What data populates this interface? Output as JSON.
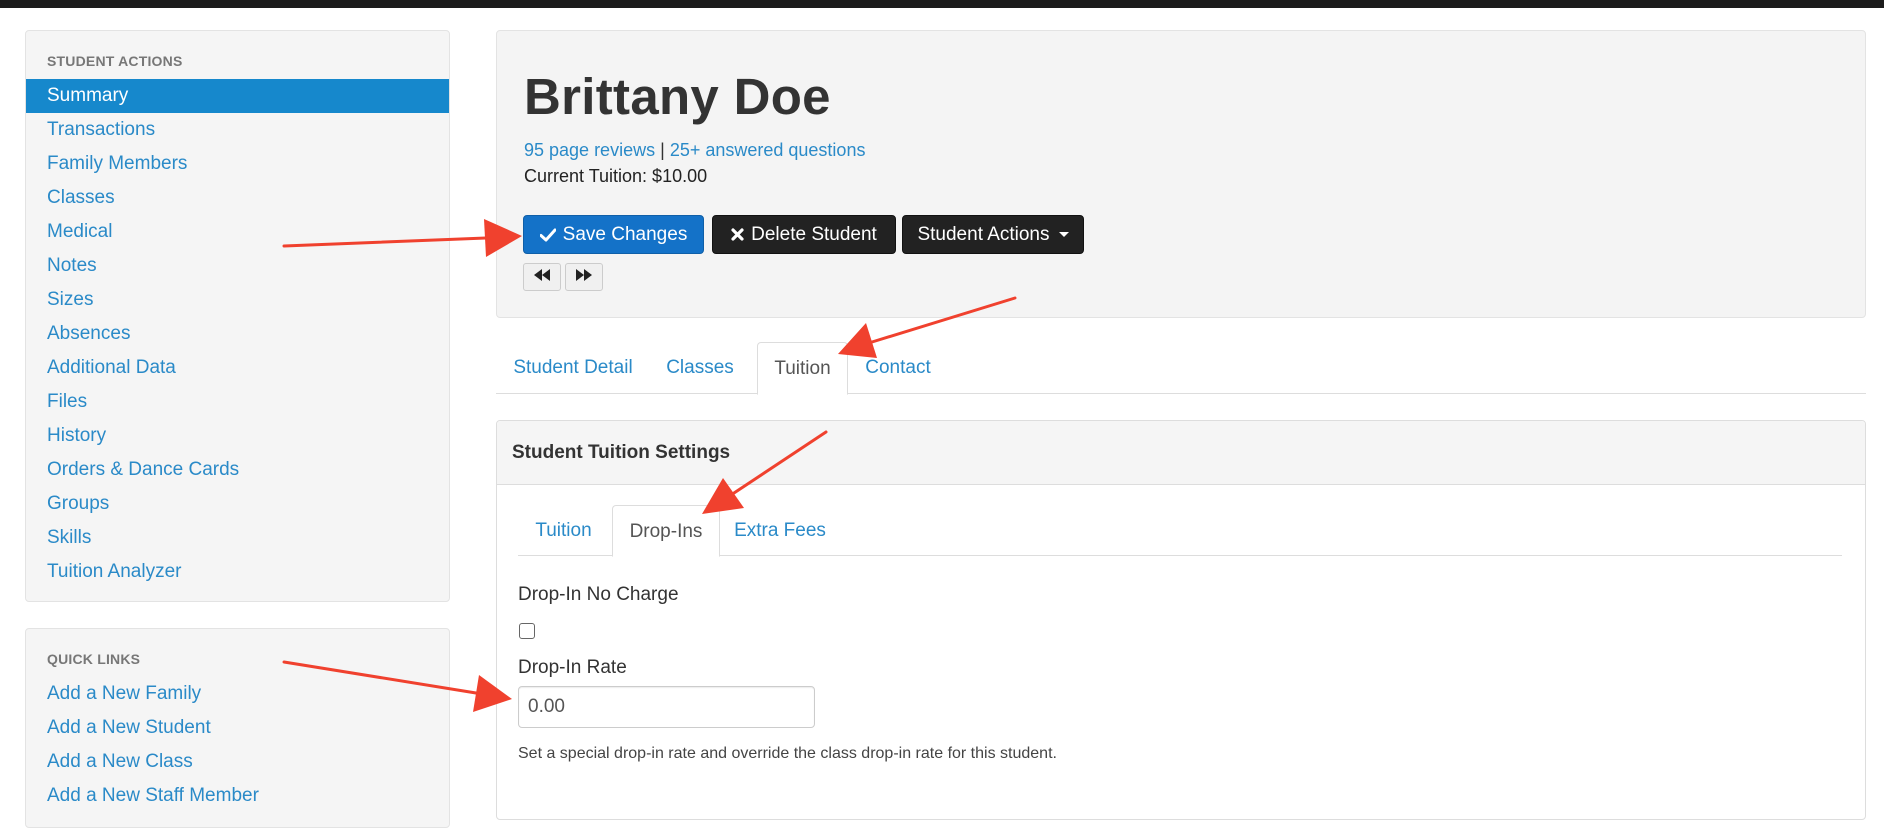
{
  "student_actions": {
    "heading": "STUDENT ACTIONS",
    "items": [
      {
        "label": "Summary",
        "active": true
      },
      {
        "label": "Transactions"
      },
      {
        "label": "Family Members"
      },
      {
        "label": "Classes"
      },
      {
        "label": "Medical"
      },
      {
        "label": "Notes"
      },
      {
        "label": "Sizes"
      },
      {
        "label": "Absences"
      },
      {
        "label": "Additional Data"
      },
      {
        "label": "Files"
      },
      {
        "label": "History"
      },
      {
        "label": "Orders & Dance Cards"
      },
      {
        "label": "Groups"
      },
      {
        "label": "Skills"
      },
      {
        "label": "Tuition Analyzer"
      }
    ]
  },
  "quick_links": {
    "heading": "QUICK LINKS",
    "items": [
      {
        "label": "Add a New Family"
      },
      {
        "label": "Add a New Student"
      },
      {
        "label": "Add a New Class"
      },
      {
        "label": "Add a New Staff Member"
      }
    ]
  },
  "header": {
    "student_name": "Brittany Doe",
    "reviews_link": "95 page reviews",
    "separator": "|",
    "questions_link": "25+ answered questions",
    "current_tuition": "Current Tuition: $10.00"
  },
  "toolbar": {
    "save_label": "Save Changes",
    "delete_label": "Delete Student",
    "actions_label": "Student Actions"
  },
  "main_tabs": [
    {
      "label": "Student Detail"
    },
    {
      "label": "Classes"
    },
    {
      "label": "Tuition",
      "active": true
    },
    {
      "label": "Contact"
    }
  ],
  "settings": {
    "title": "Student Tuition Settings",
    "sub_tabs": [
      {
        "label": "Tuition"
      },
      {
        "label": "Drop-Ins",
        "active": true
      },
      {
        "label": "Extra Fees"
      }
    ],
    "no_charge_label": "Drop-In No Charge",
    "no_charge_checked": false,
    "rate_label": "Drop-In Rate",
    "rate_value": "0.00",
    "help_text": "Set a special drop-in rate and override the class drop-in rate for this student."
  },
  "colors": {
    "accent": "#1688cc",
    "link": "#2a8ac8",
    "primary_button": "#1472c8",
    "dark_button": "#222222",
    "annotation_arrow": "#f0412e"
  },
  "icons": {
    "save": "check-icon",
    "delete": "x-icon",
    "previous": "rewind-icon",
    "next": "fast-forward-icon"
  }
}
